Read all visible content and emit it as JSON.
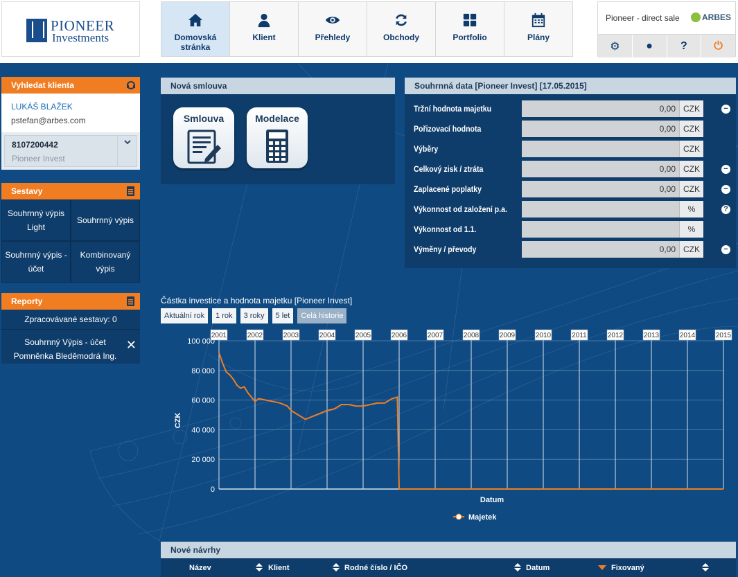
{
  "logo": {
    "line1": "PIONEER",
    "line2": "Investments"
  },
  "nav": [
    {
      "label": "Domovská stránka",
      "icon": "home-icon",
      "active": true
    },
    {
      "label": "Klient",
      "icon": "user-icon",
      "active": false
    },
    {
      "label": "Přehledy",
      "icon": "eye-icon",
      "active": false
    },
    {
      "label": "Obchody",
      "icon": "refresh-icon",
      "active": false
    },
    {
      "label": "Portfolio",
      "icon": "grid-icon",
      "active": false
    },
    {
      "label": "Plány",
      "icon": "calendar-icon",
      "active": false
    }
  ],
  "top_right": {
    "title": "Pioneer - direct sale",
    "brand": "ARBES",
    "buttons": [
      {
        "icon": "gear-icon",
        "glyph": "⚙"
      },
      {
        "icon": "chat-icon",
        "glyph": "●"
      },
      {
        "icon": "help-icon",
        "glyph": "?"
      },
      {
        "icon": "power-icon",
        "glyph": "⏻"
      }
    ]
  },
  "search_panel": {
    "title": "Vyhledat klienta",
    "client_name": "LUKÁŠ BLAŽEK",
    "client_email": "pstefan@arbes.com",
    "account_number": "8107200442",
    "account_company": "Pioneer Invest"
  },
  "sestavy": {
    "title": "Sestavy",
    "items": [
      "Souhrnný výpis Light",
      "Souhrnný výpis",
      "Souhrnný výpis - účet",
      "Kombinovaný výpis"
    ]
  },
  "reporty": {
    "title": "Reporty",
    "processed": "Zpracovávané sestavy: 0",
    "report_name": "Souhrnný Výpis - účet Pomněnka Bleděmodrá Ing."
  },
  "nova_smlouva": {
    "title": "Nová smlouva",
    "tiles": [
      "Smlouva",
      "Modelace"
    ]
  },
  "souhrnna": {
    "title": "Souhrnná data [Pioneer Invest] [17.05.2015]",
    "rows": [
      {
        "label": "Tržní hodnota majetku",
        "value": "0,00",
        "unit": "CZK",
        "icon": "−"
      },
      {
        "label": "Pořizovací hodnota",
        "value": "0,00",
        "unit": "CZK",
        "icon": ""
      },
      {
        "label": "Výběry",
        "value": "",
        "unit": "CZK",
        "icon": ""
      },
      {
        "label": "Celkový zisk / ztráta",
        "value": "0,00",
        "unit": "CZK",
        "icon": "−"
      },
      {
        "label": "Zaplacené poplatky",
        "value": "0,00",
        "unit": "CZK",
        "icon": "−"
      },
      {
        "label": "Výkonnost od založení p.a.",
        "value": "",
        "unit": "%",
        "icon": "?"
      },
      {
        "label": "Výkonnost od 1.1.",
        "value": "",
        "unit": "%",
        "icon": ""
      },
      {
        "label": "Výměny / převody",
        "value": "0,00",
        "unit": "CZK",
        "icon": "−"
      }
    ]
  },
  "chart_section": {
    "title": "Částka investice a hodnota majetku [Pioneer Invest]",
    "range_buttons": [
      "Aktuální rok",
      "1 rok",
      "3 roky",
      "5 let",
      "Celá historie"
    ],
    "selected_range": "Celá historie"
  },
  "chart_data": {
    "type": "line",
    "xlabel": "Datum",
    "ylabel": "CZK",
    "ylim": [
      0,
      100000
    ],
    "yticks": [
      "100 000",
      "80 000",
      "60 000",
      "40 000",
      "20 000",
      "0"
    ],
    "x_ticks": [
      "2001",
      "2002",
      "2003",
      "2004",
      "2005",
      "2006",
      "2007",
      "2008",
      "2009",
      "2010",
      "2011",
      "2012",
      "2013",
      "2014",
      "2015"
    ],
    "grid": true,
    "legend": "bottom",
    "series": [
      {
        "name": "Majetek",
        "color": "#f07d22",
        "points": [
          [
            2001.0,
            92000
          ],
          [
            2001.1,
            85000
          ],
          [
            2001.2,
            79000
          ],
          [
            2001.3,
            77000
          ],
          [
            2001.4,
            74000
          ],
          [
            2001.5,
            70000
          ],
          [
            2001.6,
            68000
          ],
          [
            2001.7,
            69000
          ],
          [
            2001.8,
            65000
          ],
          [
            2001.9,
            62000
          ],
          [
            2002.0,
            59000
          ],
          [
            2002.1,
            61000
          ],
          [
            2002.3,
            60000
          ],
          [
            2002.5,
            59000
          ],
          [
            2002.7,
            58000
          ],
          [
            2002.9,
            56000
          ],
          [
            2003.0,
            53000
          ],
          [
            2003.2,
            50000
          ],
          [
            2003.4,
            47000
          ],
          [
            2003.6,
            49000
          ],
          [
            2003.8,
            51000
          ],
          [
            2004.0,
            53000
          ],
          [
            2004.2,
            54000
          ],
          [
            2004.4,
            57000
          ],
          [
            2004.6,
            57000
          ],
          [
            2004.8,
            56000
          ],
          [
            2005.0,
            56000
          ],
          [
            2005.2,
            57000
          ],
          [
            2005.4,
            58000
          ],
          [
            2005.6,
            58000
          ],
          [
            2005.8,
            61000
          ],
          [
            2005.95,
            62000
          ],
          [
            2006.0,
            0
          ],
          [
            2015.0,
            0
          ]
        ]
      }
    ]
  },
  "navrhy": {
    "title": "Nové návrhy",
    "columns": [
      "Název",
      "Klient",
      "Rodné číslo / IČO",
      "Datum",
      "Fixovaný"
    ]
  }
}
